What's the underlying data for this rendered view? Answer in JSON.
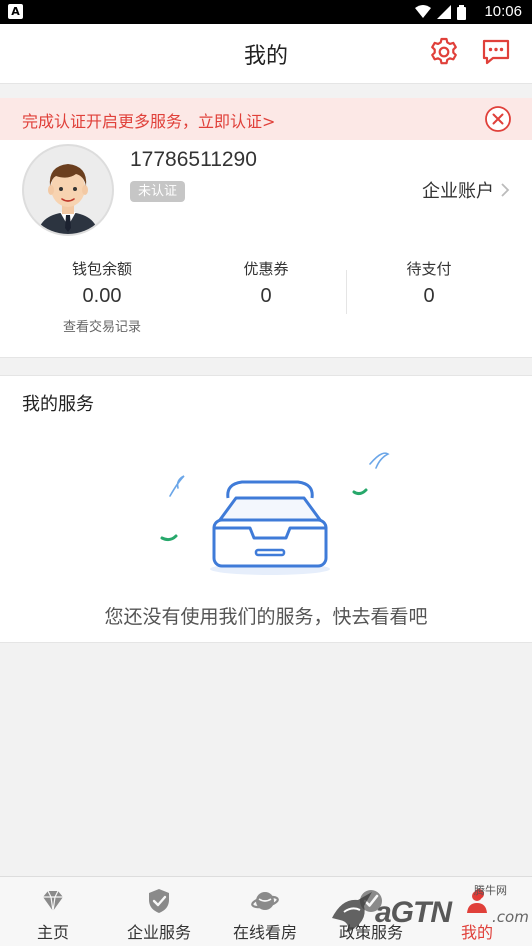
{
  "status_bar": {
    "app_badge": "A",
    "time": "10:06"
  },
  "header": {
    "title": "我的",
    "settings_icon": "gear-icon",
    "message_icon": "chat-bubble-icon",
    "accent": "#e0403a"
  },
  "notice": {
    "text": "完成认证开启更多服务，立即认证>",
    "close_icon": "close-circle-icon"
  },
  "profile": {
    "phone": "17786511290",
    "verify_badge": "未认证",
    "enterprise_account": "企业账户",
    "stats": [
      {
        "label": "钱包余额",
        "value": "0.00",
        "sub": "查看交易记录"
      },
      {
        "label": "优惠券",
        "value": "0"
      },
      {
        "label": "待支付",
        "value": "0"
      }
    ]
  },
  "services": {
    "title": "我的服务",
    "empty_text": "您还没有使用我们的服务，快去看看吧",
    "illustration_icon": "empty-inbox-icon"
  },
  "tabbar": {
    "items": [
      {
        "label": "主页",
        "icon": "diamond-icon"
      },
      {
        "label": "企业服务",
        "icon": "shield-check-icon"
      },
      {
        "label": "在线看房",
        "icon": "planet-icon"
      },
      {
        "label": "政策服务",
        "icon": "check-badge-icon"
      },
      {
        "label": "我的",
        "icon": "person-icon"
      }
    ]
  },
  "watermark": {
    "text": "aGTN",
    "small": "腾牛网",
    "suffix": ".com"
  }
}
